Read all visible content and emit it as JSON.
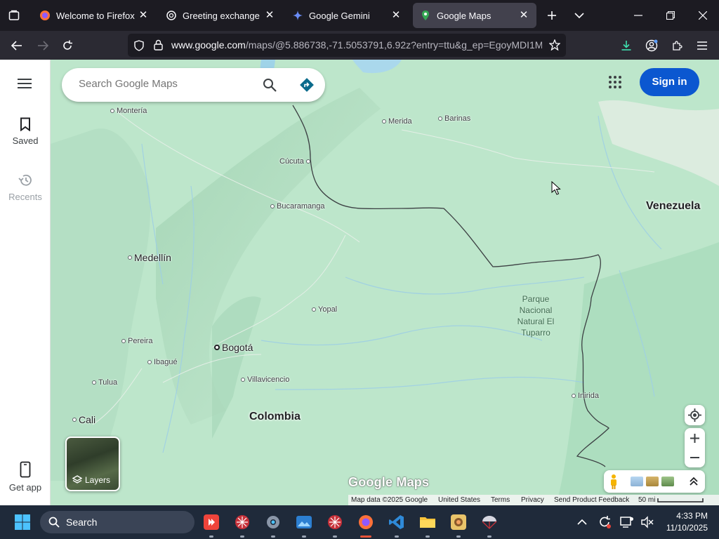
{
  "browser": {
    "tabs": [
      {
        "title": "Welcome to Firefox",
        "icon": "firefox-icon",
        "active": false
      },
      {
        "title": "Greeting exchange",
        "icon": "chatgpt-icon",
        "active": false
      },
      {
        "title": "Google Gemini",
        "icon": "gemini-icon",
        "active": false
      },
      {
        "title": "Google Maps",
        "icon": "google-maps-icon",
        "active": true
      }
    ],
    "url_host": "www.google.com",
    "url_path": "/maps/@5.886738,-71.5053791,6.92z?entry=ttu&g_ep=EgoyMDI1MTE"
  },
  "maps": {
    "search_placeholder": "Search Google Maps",
    "signin_label": "Sign in",
    "rail": {
      "saved": "Saved",
      "recents": "Recents",
      "get_app": "Get app"
    },
    "layers_label": "Layers",
    "logo": "Google Maps",
    "cities": [
      {
        "name": "Montería",
        "kind": "small"
      },
      {
        "name": "Merida",
        "kind": "small"
      },
      {
        "name": "Barinas",
        "kind": "small"
      },
      {
        "name": "Cúcuta",
        "kind": "small"
      },
      {
        "name": "Bucaramanga",
        "kind": "small"
      },
      {
        "name": "Medellín",
        "kind": "big"
      },
      {
        "name": "Yopal",
        "kind": "small"
      },
      {
        "name": "Pereira",
        "kind": "small"
      },
      {
        "name": "Bogotá",
        "kind": "capital"
      },
      {
        "name": "Ibagué",
        "kind": "small"
      },
      {
        "name": "Tulua",
        "kind": "small"
      },
      {
        "name": "Villavicencio",
        "kind": "small"
      },
      {
        "name": "Cali",
        "kind": "big"
      },
      {
        "name": "Inirida",
        "kind": "small"
      }
    ],
    "countries": {
      "venezuela": "Venezuela",
      "colombia": "Colombia"
    },
    "park": "Parque\nNacional\nNatural El\nTuparro",
    "attribution": {
      "map_data": "Map data ©2025 Google",
      "region": "United States",
      "terms": "Terms",
      "privacy": "Privacy",
      "feedback": "Send Product Feedback",
      "scale": "50 mi"
    }
  },
  "taskbar": {
    "search_label": "Search",
    "time": "4:33 PM",
    "date": "11/10/2025",
    "apps": [
      "anydesk-icon",
      "app-red-icon",
      "settings-icon",
      "photos-icon",
      "app-red2-icon",
      "firefox-icon",
      "vscode-icon",
      "file-explorer-icon",
      "game-icon",
      "app-parachute-icon"
    ]
  },
  "colors": {
    "map_land": "#b9e3c8",
    "signin_blue": "#0b57d0",
    "tab_active": "#42414d",
    "taskbar": "#1f2a3a"
  }
}
